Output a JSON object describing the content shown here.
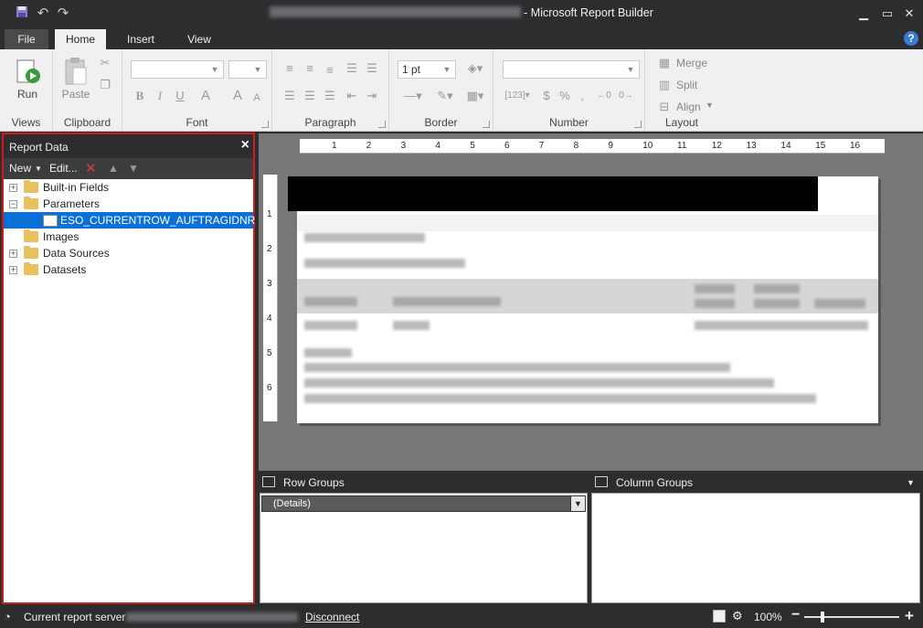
{
  "window": {
    "title": "- Microsoft Report Builder",
    "minimize_icon": "minimize-icon",
    "restore_icon": "restore-icon",
    "close_icon": "close-icon"
  },
  "tabs": [
    {
      "label": "File"
    },
    {
      "label": "Home",
      "active": true
    },
    {
      "label": "Insert"
    },
    {
      "label": "View"
    }
  ],
  "help_label": "?",
  "ribbon": {
    "views": {
      "label": "Views",
      "run": "Run"
    },
    "clipboard": {
      "label": "Clipboard",
      "paste": "Paste"
    },
    "font": {
      "label": "Font",
      "bold": "B",
      "italic": "I",
      "underline": "U",
      "color": "A",
      "grow": "A",
      "shrink": "A"
    },
    "paragraph": {
      "label": "Paragraph"
    },
    "border": {
      "label": "Border",
      "size": "1 pt"
    },
    "number": {
      "label": "Number",
      "currency": "$",
      "percent": "%",
      "comma": ","
    },
    "layout": {
      "label": "Layout",
      "merge": "Merge",
      "split": "Split",
      "align": "Align"
    }
  },
  "report_data": {
    "title": "Report Data",
    "toolbar": {
      "new": "New",
      "edit": "Edit..."
    },
    "tree": [
      {
        "label": "Built-in Fields",
        "expander": "+",
        "level": 0
      },
      {
        "label": "Parameters",
        "expander": "−",
        "level": 0
      },
      {
        "label": "ESO_CURRENTROW_AUFTRAGIDNR",
        "level": 1,
        "selected": true
      },
      {
        "label": "Images",
        "expander": "",
        "level": 0
      },
      {
        "label": "Data Sources",
        "expander": "+",
        "level": 0
      },
      {
        "label": "Datasets",
        "expander": "+",
        "level": 0
      }
    ]
  },
  "ruler": {
    "horizontal": [
      "1",
      "2",
      "3",
      "4",
      "5",
      "6",
      "7",
      "8",
      "9",
      "10",
      "11",
      "12",
      "13",
      "14",
      "15",
      "16"
    ],
    "vertical": [
      "1",
      "2",
      "3",
      "4",
      "5",
      "6"
    ]
  },
  "groups": {
    "row_title": "Row Groups",
    "column_title": "Column Groups",
    "row_items": [
      {
        "label": "(Details)"
      }
    ]
  },
  "status": {
    "server_label": "Current report server",
    "disconnect": "Disconnect",
    "zoom": "100%",
    "zoom_out": "−",
    "zoom_in": "+",
    "zoom_level": 0.18
  }
}
